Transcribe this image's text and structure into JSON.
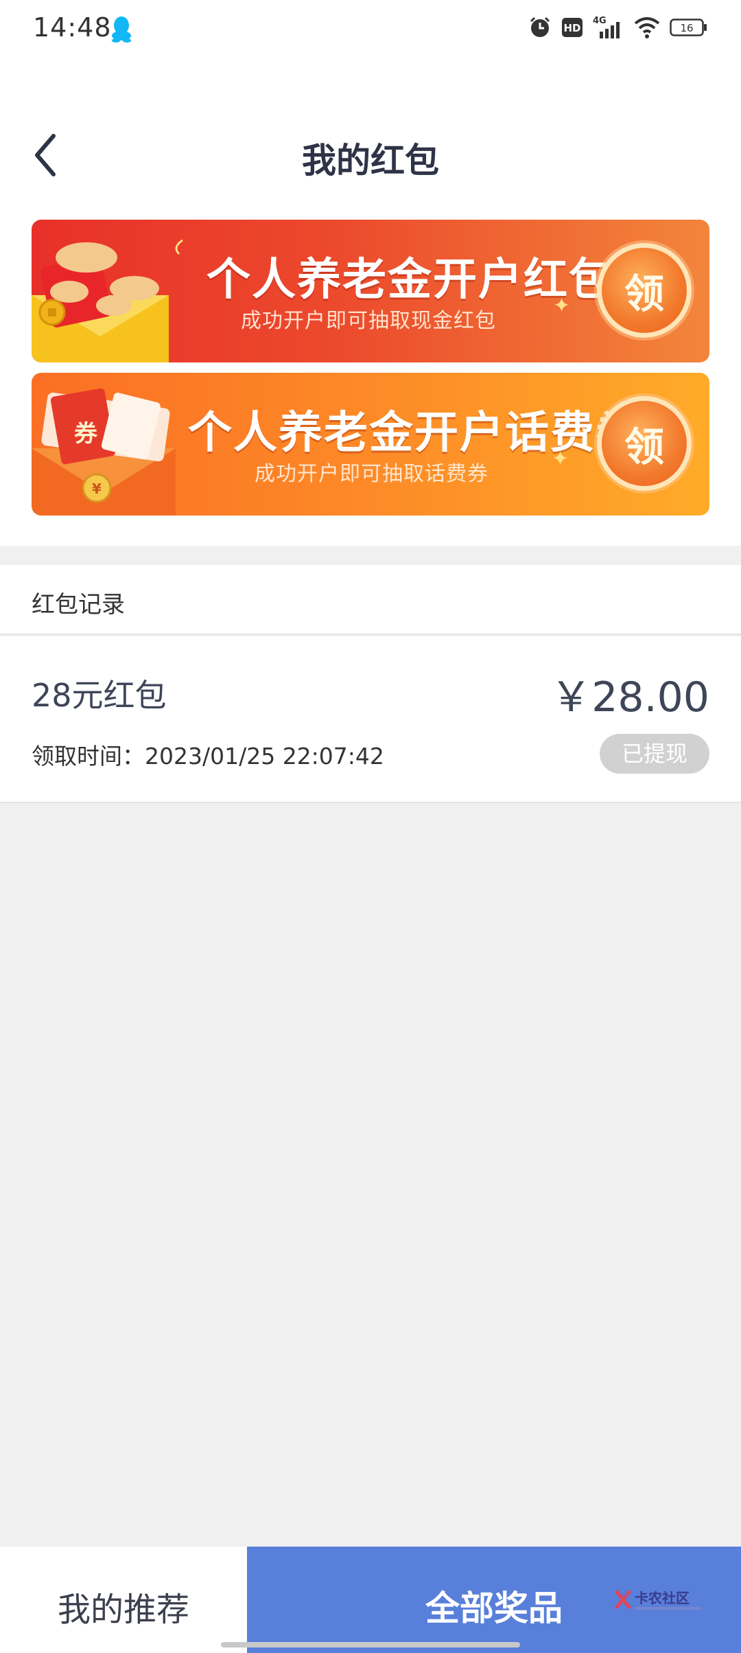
{
  "status_bar": {
    "time": "14:48",
    "battery_level": "16",
    "network": "4G",
    "hd_label": "HD",
    "icons": [
      "qq-icon",
      "alarm-icon",
      "hd-icon",
      "signal-icon",
      "wifi-icon",
      "battery-icon"
    ]
  },
  "nav": {
    "title": "我的红包",
    "back_icon": "back-chevron-icon"
  },
  "banners": [
    {
      "title": "个人养老金开户红包",
      "subtitle": "成功开户即可抽取现金红包",
      "button": "领"
    },
    {
      "title": "个人养老金开户话费券",
      "subtitle": "成功开户即可抽取话费券",
      "button": "领",
      "art_label": "券",
      "coin_symbol": "¥"
    }
  ],
  "records": {
    "title": "红包记录",
    "items": [
      {
        "name": "28元红包",
        "amount": "￥28.00",
        "time": "领取时间：2023/01/25 22:07:42",
        "status": "已提现"
      }
    ]
  },
  "bottom_tabs": {
    "recommend": "我的推荐",
    "all_prizes": "全部奖品",
    "watermark": "卡农社区"
  },
  "colors": {
    "nav_title": "#2e3346",
    "banner1_start": "#e8302a",
    "banner1_end": "#f3853b",
    "banner2_start": "#fb6f25",
    "banner2_end": "#ffab29",
    "tab_active_bg": "#587fd9",
    "status_badge_bg": "#d1d1d1",
    "page_bg": "#f0f0f0"
  }
}
